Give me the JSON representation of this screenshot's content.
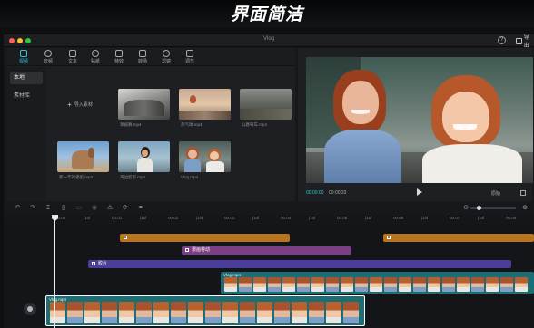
{
  "banner": {
    "title": "界面简洁"
  },
  "window": {
    "title": "Vlog",
    "traffic_lights": [
      "#ff5f57",
      "#febc2e",
      "#28c840"
    ],
    "export_label": "导出",
    "help_icon": "question-circle-icon"
  },
  "media": {
    "tabs": [
      {
        "label": "视频",
        "icon": "media-icon",
        "active": true
      },
      {
        "label": "音频",
        "icon": "audio-icon",
        "active": false
      },
      {
        "label": "文本",
        "icon": "text-icon",
        "active": false
      },
      {
        "label": "贴纸",
        "icon": "sticker-icon",
        "active": false
      },
      {
        "label": "特效",
        "icon": "effects-icon",
        "active": false
      },
      {
        "label": "转场",
        "icon": "transition-icon",
        "active": false
      },
      {
        "label": "滤镜",
        "icon": "filter-icon",
        "active": false
      },
      {
        "label": "调节",
        "icon": "adjust-icon",
        "active": false
      }
    ],
    "sidebar": [
      {
        "label": "本地",
        "active": true
      },
      {
        "label": "素材库",
        "active": false
      }
    ],
    "import_label": "导入素材",
    "items": [
      {
        "caption": "草坡舞.mp4"
      },
      {
        "caption": "热气球.mp4"
      },
      {
        "caption": "公路驾车.mp4"
      },
      {
        "caption": "新一年的骆驼.mp4"
      },
      {
        "caption": "海边剪影.mp4"
      },
      {
        "caption": "Vlog.mp4"
      }
    ]
  },
  "player": {
    "current_time": "00:00:00",
    "total_time": "00:00:33",
    "ratio_label": "原始",
    "accent": "#34c8d6"
  },
  "timeline": {
    "ruler_ticks": [
      "00:00",
      "|10f",
      "00:01",
      "|10f",
      "00:02",
      "|10f",
      "00:03",
      "|10f",
      "00:04",
      "|10f",
      "00:05",
      "|10f",
      "00:06",
      "|10f",
      "00:07",
      "|10f",
      "00:08"
    ],
    "sticker_color": "#b8741e",
    "effect_label": "漫画卷动",
    "effect_color": "#7b3f88",
    "filter_label": "胶片",
    "filter_color": "#4a3d9c",
    "clip_top_label": "Vlog.mp4",
    "clip_main_label": "Vlog.mp4",
    "clip_color": "#1d6e74"
  }
}
